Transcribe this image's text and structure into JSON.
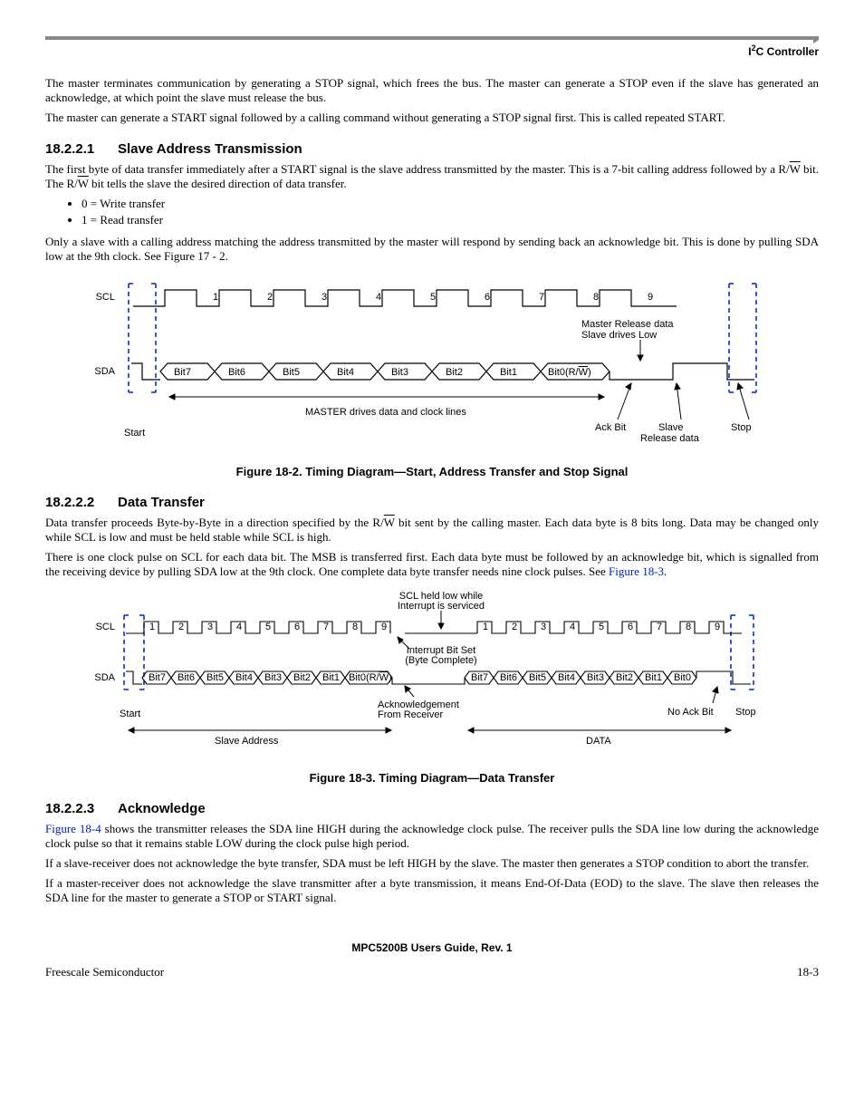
{
  "header": {
    "label_html": "I<sup>2</sup>C Controller"
  },
  "p1": "The master terminates communication by generating a STOP signal, which frees the bus. The master can generate a STOP even if the slave has generated an acknowledge, at which point the slave must release the bus.",
  "p2": "The master can generate a START signal followed by a calling command without generating a STOP signal first. This is called repeated START.",
  "s1": {
    "num": "18.2.2.1",
    "title": "Slave Address Transmission"
  },
  "p3a": "The first byte of data transfer immediately after a START signal is the slave address transmitted by the master. This is a 7-bit calling address followed by a R/",
  "p3b": " bit. The R/",
  "p3c": " bit tells the slave the desired direction of data transfer.",
  "w": "W",
  "li1": "0 = Write transfer",
  "li2": "1 = Read transfer",
  "p4": "Only a slave with a calling address matching the address transmitted by the master will respond by sending back an acknowledge bit. This is done by pulling SDA low at the 9th clock. See Figure 17 - 2.",
  "fig1": {
    "scl": "SCL",
    "sda": "SDA",
    "nums": [
      "1",
      "2",
      "3",
      "4",
      "5",
      "6",
      "7",
      "8",
      "9"
    ],
    "bits": [
      "Bit7",
      "Bit6",
      "Bit5",
      "Bit4",
      "Bit3",
      "Bit2",
      "Bit1",
      "Bit0(R/W)"
    ],
    "master_release": "Master Release data",
    "slave_low": "Slave drives Low",
    "master_drives": "MASTER drives data and clock lines",
    "start": "Start",
    "ack": "Ack Bit",
    "slave_release": "Slave",
    "release_data": "Release data",
    "stop": "Stop",
    "caption": "Figure 18-2. Timing Diagram—Start, Address Transfer and Stop Signal"
  },
  "s2": {
    "num": "18.2.2.2",
    "title": "Data Transfer"
  },
  "p5a": "Data transfer proceeds Byte-by-Byte in a direction specified by the R/",
  "p5b": " bit sent by the calling master. Each data byte is 8 bits long. Data may be changed only while SCL is low and must be held stable while SCL is high.",
  "p6": "There is one clock pulse on SCL for each data bit. The MSB is transferred first. Each data byte must be followed by an acknowledge bit, which is signalled from the receiving device by pulling SDA low at the 9th clock. One complete data byte transfer needs nine clock pulses. See ",
  "p6link": "Figure 18-3",
  "fig2": {
    "scl": "SCL",
    "sda": "SDA",
    "scl_held1": "SCL held low while",
    "scl_held2": "Interrupt is serviced",
    "int_set1": "Interrupt Bit Set",
    "int_set2": "(Byte Complete)",
    "bits": [
      "Bit7",
      "Bit6",
      "Bit5",
      "Bit4",
      "Bit3",
      "Bit2",
      "Bit1",
      "Bit0(R/W)"
    ],
    "bits2": [
      "Bit7",
      "Bit6",
      "Bit5",
      "Bit4",
      "Bit3",
      "Bit2",
      "Bit1",
      "Bit0"
    ],
    "nums1": [
      "1",
      "2",
      "3",
      "4",
      "5",
      "6",
      "7",
      "8",
      "9"
    ],
    "nums2": [
      "1",
      "2",
      "3",
      "4",
      "5",
      "6",
      "7",
      "8",
      "9"
    ],
    "ack1": "Acknowledgement",
    "ack2": "From Receiver",
    "start": "Start",
    "noack": "No Ack Bit",
    "stop": "Stop",
    "slave_addr": "Slave Address",
    "data": "DATA",
    "caption": "Figure 18-3. Timing Diagram—Data Transfer"
  },
  "s3": {
    "num": "18.2.2.3",
    "title": "Acknowledge"
  },
  "p7link": "Figure 18-4",
  "p7": " shows the transmitter releases the SDA line HIGH during the acknowledge clock pulse. The receiver pulls the SDA line low during the acknowledge clock pulse so that it remains stable LOW during the clock pulse high period.",
  "p8": "If a slave-receiver does not acknowledge the byte transfer, SDA must be left HIGH by the slave. The master then generates a STOP condition to abort the transfer.",
  "p9": "If a master-receiver does not acknowledge the slave transmitter after a byte transmission, it means End-Of-Data (EOD) to the slave. The slave then releases the SDA line for the master to generate a STOP or START signal.",
  "footer": {
    "title": "MPC5200B Users Guide, Rev. 1",
    "left": "Freescale Semiconductor",
    "right": "18-3"
  }
}
